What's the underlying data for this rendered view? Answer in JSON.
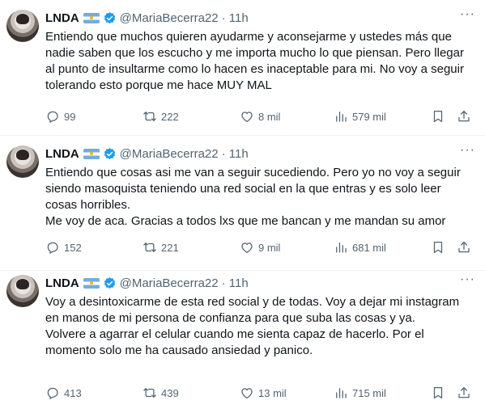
{
  "tweets": [
    {
      "name": "LNDA",
      "handle": "@MariaBecerra22",
      "time": "· 11h",
      "more": "···",
      "text": "Entiendo que muchos quieren ayudarme y aconsejarme y ustedes más que nadie saben que los escucho y me importa mucho lo que piensan. Pero llegar al punto de insultarme como lo hacen es inaceptable para mi. No voy a seguir tolerando esto porque me hace MUY MAL",
      "replies": "99",
      "retweets": "222",
      "likes": "8 mil",
      "views": "579 mil"
    },
    {
      "name": "LNDA",
      "handle": "@MariaBecerra22",
      "time": "· 11h",
      "more": "···",
      "text": "Entiendo que cosas asi me van a seguir sucediendo. Pero yo no voy a seguir siendo masoquista teniendo una red social en la que entras y es solo leer cosas horribles.\nMe voy de aca. Gracias a todos lxs que me bancan y me mandan su amor",
      "replies": "152",
      "retweets": "221",
      "likes": "9 mil",
      "views": "681 mil"
    },
    {
      "name": "LNDA",
      "handle": "@MariaBecerra22",
      "time": "· 11h",
      "more": "···",
      "text": "Voy a desintoxicarme de esta red social y de todas. Voy a dejar mi instagram en manos de mi persona de confianza para que suba las cosas y ya.\nVolvere a agarrar el celular cuando me sienta capaz de hacerlo. Por el momento solo me ha causado ansiedad y panico.",
      "replies": "413",
      "retweets": "439",
      "likes": "13 mil",
      "views": "715 mil"
    }
  ],
  "icons": [
    "avatar",
    "argentina-flag-icon",
    "verified-badge-icon",
    "more-icon",
    "reply-icon",
    "retweet-icon",
    "like-icon",
    "views-icon",
    "bookmark-icon",
    "share-icon"
  ],
  "colors": {
    "text": "#0f1419",
    "secondary": "#536471",
    "verified": "#1d9bf0",
    "divider": "#eff3f4"
  }
}
